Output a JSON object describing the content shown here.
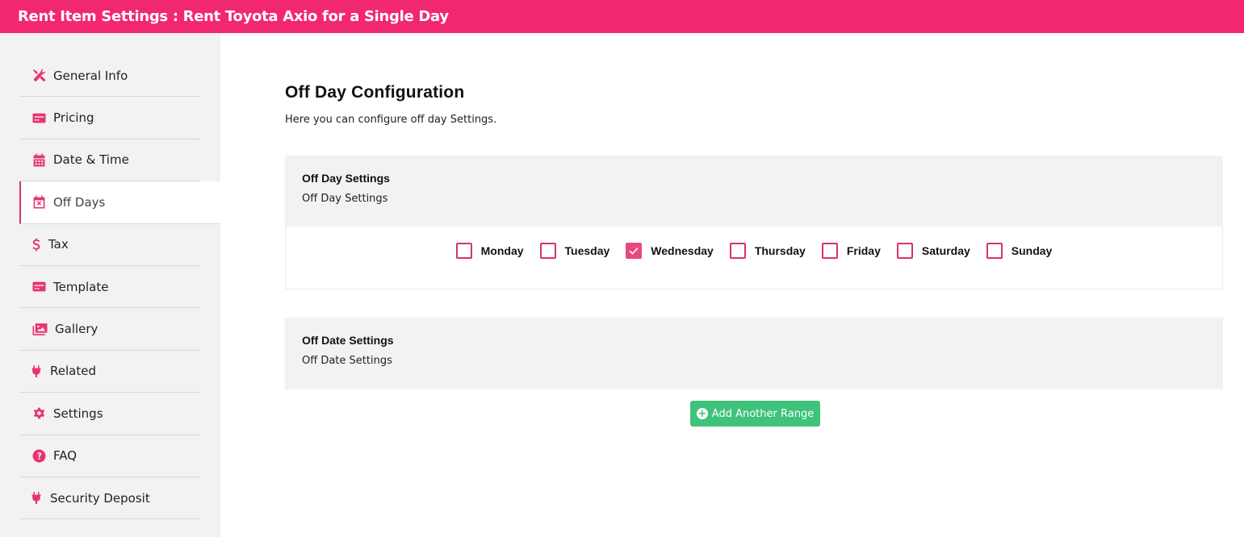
{
  "header": {
    "title": "Rent Item Settings : Rent Toyota Axio for a Single Day"
  },
  "theme": {
    "accent": "#f22771",
    "icon_color": "#e8336f",
    "button_green": "#3fc27a",
    "panel_bg": "#f2f2f2"
  },
  "sidebar": {
    "items": [
      {
        "label": "General Info",
        "icon": "tools-icon",
        "active": false
      },
      {
        "label": "Pricing",
        "icon": "credit-card-icon",
        "active": false
      },
      {
        "label": "Date & Time",
        "icon": "calendar-icon",
        "active": false
      },
      {
        "label": "Off Days",
        "icon": "calendar-x-icon",
        "active": true
      },
      {
        "label": "Tax",
        "icon": "dollar-icon",
        "active": false
      },
      {
        "label": "Template",
        "icon": "credit-card-icon",
        "active": false
      },
      {
        "label": "Gallery",
        "icon": "images-icon",
        "active": false
      },
      {
        "label": "Related",
        "icon": "plug-icon",
        "active": false
      },
      {
        "label": "Settings",
        "icon": "gear-icon",
        "active": false
      },
      {
        "label": "FAQ",
        "icon": "question-circle-icon",
        "active": false
      },
      {
        "label": "Security Deposit",
        "icon": "plug-icon",
        "active": false
      }
    ]
  },
  "main": {
    "title": "Off Day Configuration",
    "description": "Here you can configure off day Settings.",
    "off_day_section": {
      "heading": "Off Day Settings",
      "subheading": "Off Day Settings",
      "days": [
        {
          "label": "Monday",
          "checked": false
        },
        {
          "label": "Tuesday",
          "checked": false
        },
        {
          "label": "Wednesday",
          "checked": true
        },
        {
          "label": "Thursday",
          "checked": false
        },
        {
          "label": "Friday",
          "checked": false
        },
        {
          "label": "Saturday",
          "checked": false
        },
        {
          "label": "Sunday",
          "checked": false
        }
      ]
    },
    "off_date_section": {
      "heading": "Off Date Settings",
      "subheading": "Off Date Settings",
      "add_button_label": "Add Another Range"
    }
  }
}
